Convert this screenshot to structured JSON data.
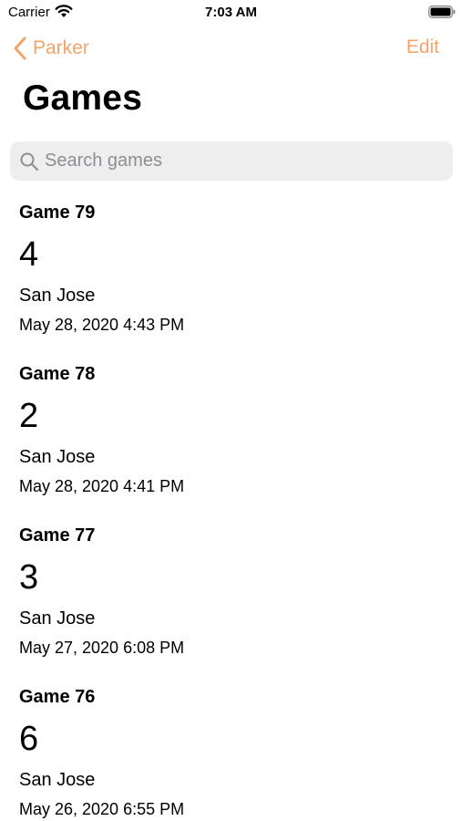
{
  "status_bar": {
    "carrier": "Carrier",
    "time": "7:03 AM",
    "icons": [
      "wifi-icon",
      "battery-icon"
    ]
  },
  "nav": {
    "back_label": "Parker",
    "edit_label": "Edit",
    "accent_color": "#f4a46a"
  },
  "page": {
    "title": "Games"
  },
  "search": {
    "placeholder": "Search games",
    "value": ""
  },
  "games": [
    {
      "title": "Game 79",
      "score": "4",
      "location": "San Jose",
      "date": "May 28, 2020 4:43 PM"
    },
    {
      "title": "Game 78",
      "score": "2",
      "location": "San Jose",
      "date": "May 28, 2020 4:41 PM"
    },
    {
      "title": "Game 77",
      "score": "3",
      "location": "San Jose",
      "date": "May 27, 2020 6:08 PM"
    },
    {
      "title": "Game 76",
      "score": "6",
      "location": "San Jose",
      "date": "May 26, 2020 6:55 PM"
    }
  ]
}
